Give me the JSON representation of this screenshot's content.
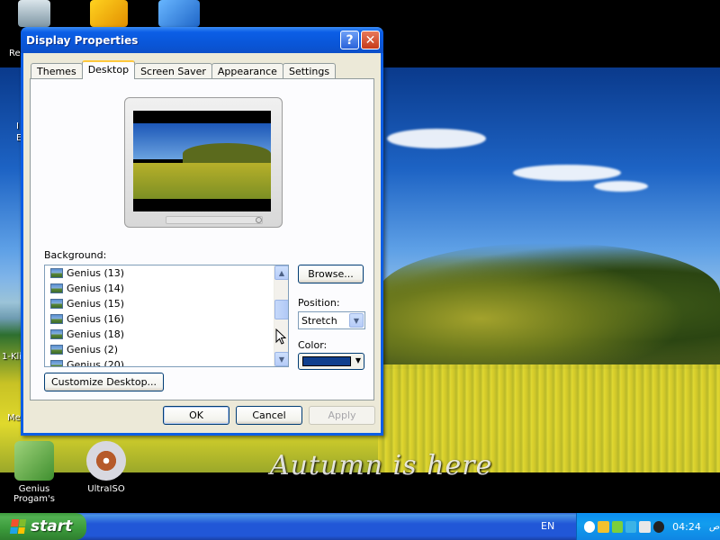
{
  "desktop": {
    "tagline": "Autumn is here",
    "icons": [
      {
        "label": "Genius\nProgam's"
      },
      {
        "label": "UltraISO"
      }
    ],
    "partial_labels": [
      "Re",
      "I",
      "E",
      "1-Kli",
      "Me"
    ]
  },
  "window": {
    "title": "Display Properties",
    "help_symbol": "?",
    "close_symbol": "✕",
    "tabs": [
      {
        "label": "Themes"
      },
      {
        "label": "Desktop"
      },
      {
        "label": "Screen Saver"
      },
      {
        "label": "Appearance"
      },
      {
        "label": "Settings"
      }
    ],
    "background_label": "Background:",
    "background_items": [
      "Genius (13)",
      "Genius (14)",
      "Genius (15)",
      "Genius (16)",
      "Genius (18)",
      "Genius (2)",
      "Genius (20)"
    ],
    "browse_label": "Browse...",
    "position_label": "Position:",
    "position_value": "Stretch",
    "color_label": "Color:",
    "color_value": "#0f3f8e",
    "customize_label": "Customize Desktop...",
    "ok_label": "OK",
    "cancel_label": "Cancel",
    "apply_label": "Apply"
  },
  "taskbar": {
    "start_label": "start",
    "language": "EN",
    "clock": "04:24",
    "ampm": "ص"
  }
}
